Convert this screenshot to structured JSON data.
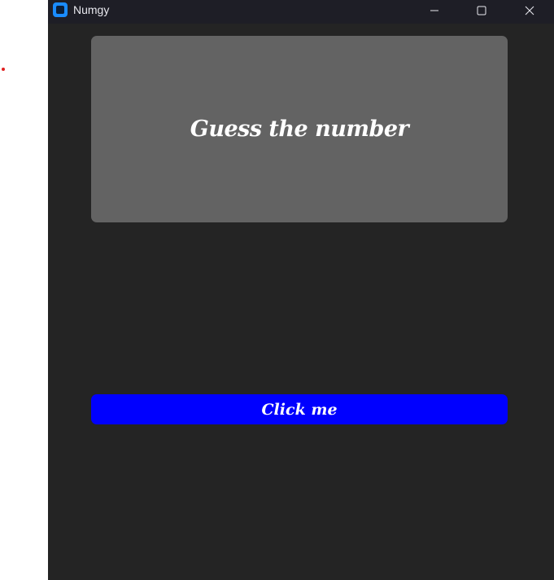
{
  "window": {
    "title": "Numgy",
    "app_icon": "app-icon",
    "controls": {
      "minimize_icon": "minimize-icon",
      "maximize_icon": "maximize-icon",
      "close_icon": "close-icon"
    }
  },
  "main": {
    "heading": "Guess the number",
    "button_label": "Click me"
  },
  "colors": {
    "window_background": "#242424",
    "titlebar_background": "#1e1e26",
    "card_background": "#636363",
    "button_background": "#0000ff",
    "text": "#ffffff",
    "accent_icon": "#1a8cff"
  }
}
